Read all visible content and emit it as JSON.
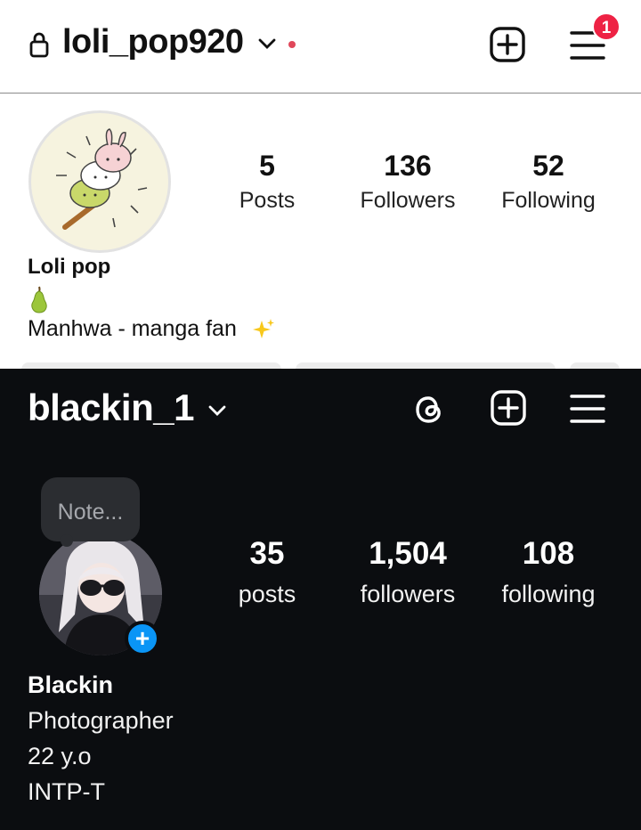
{
  "light_profile": {
    "username": "loli_pop920",
    "notification_count": "1",
    "stats": [
      {
        "value": "5",
        "label": "Posts"
      },
      {
        "value": "136",
        "label": "Followers"
      },
      {
        "value": "52",
        "label": "Following"
      }
    ],
    "display_name": "Loli pop",
    "bio": "Manhwa - manga fan",
    "icons": [
      "lock-icon",
      "chevron-down-icon",
      "notification-dot",
      "new-post-icon",
      "menu-icon",
      "pear-emoji",
      "sparkles-emoji"
    ]
  },
  "dark_profile": {
    "username": "blackin_1",
    "note_placeholder": "Note...",
    "add_story": "+",
    "stats": [
      {
        "value": "35",
        "label": "posts"
      },
      {
        "value": "1,504",
        "label": "followers"
      },
      {
        "value": "108",
        "label": "following"
      }
    ],
    "display_name": "Blackin",
    "bio_lines": [
      "Photographer",
      "22 y.o",
      "INTP-T"
    ],
    "icons": [
      "chevron-down-icon",
      "threads-icon",
      "new-post-icon",
      "menu-icon"
    ]
  },
  "colors": {
    "accent_blue": "#0a95f6",
    "badge_red": "#ee2244",
    "dark_bg": "#0b0d10"
  }
}
